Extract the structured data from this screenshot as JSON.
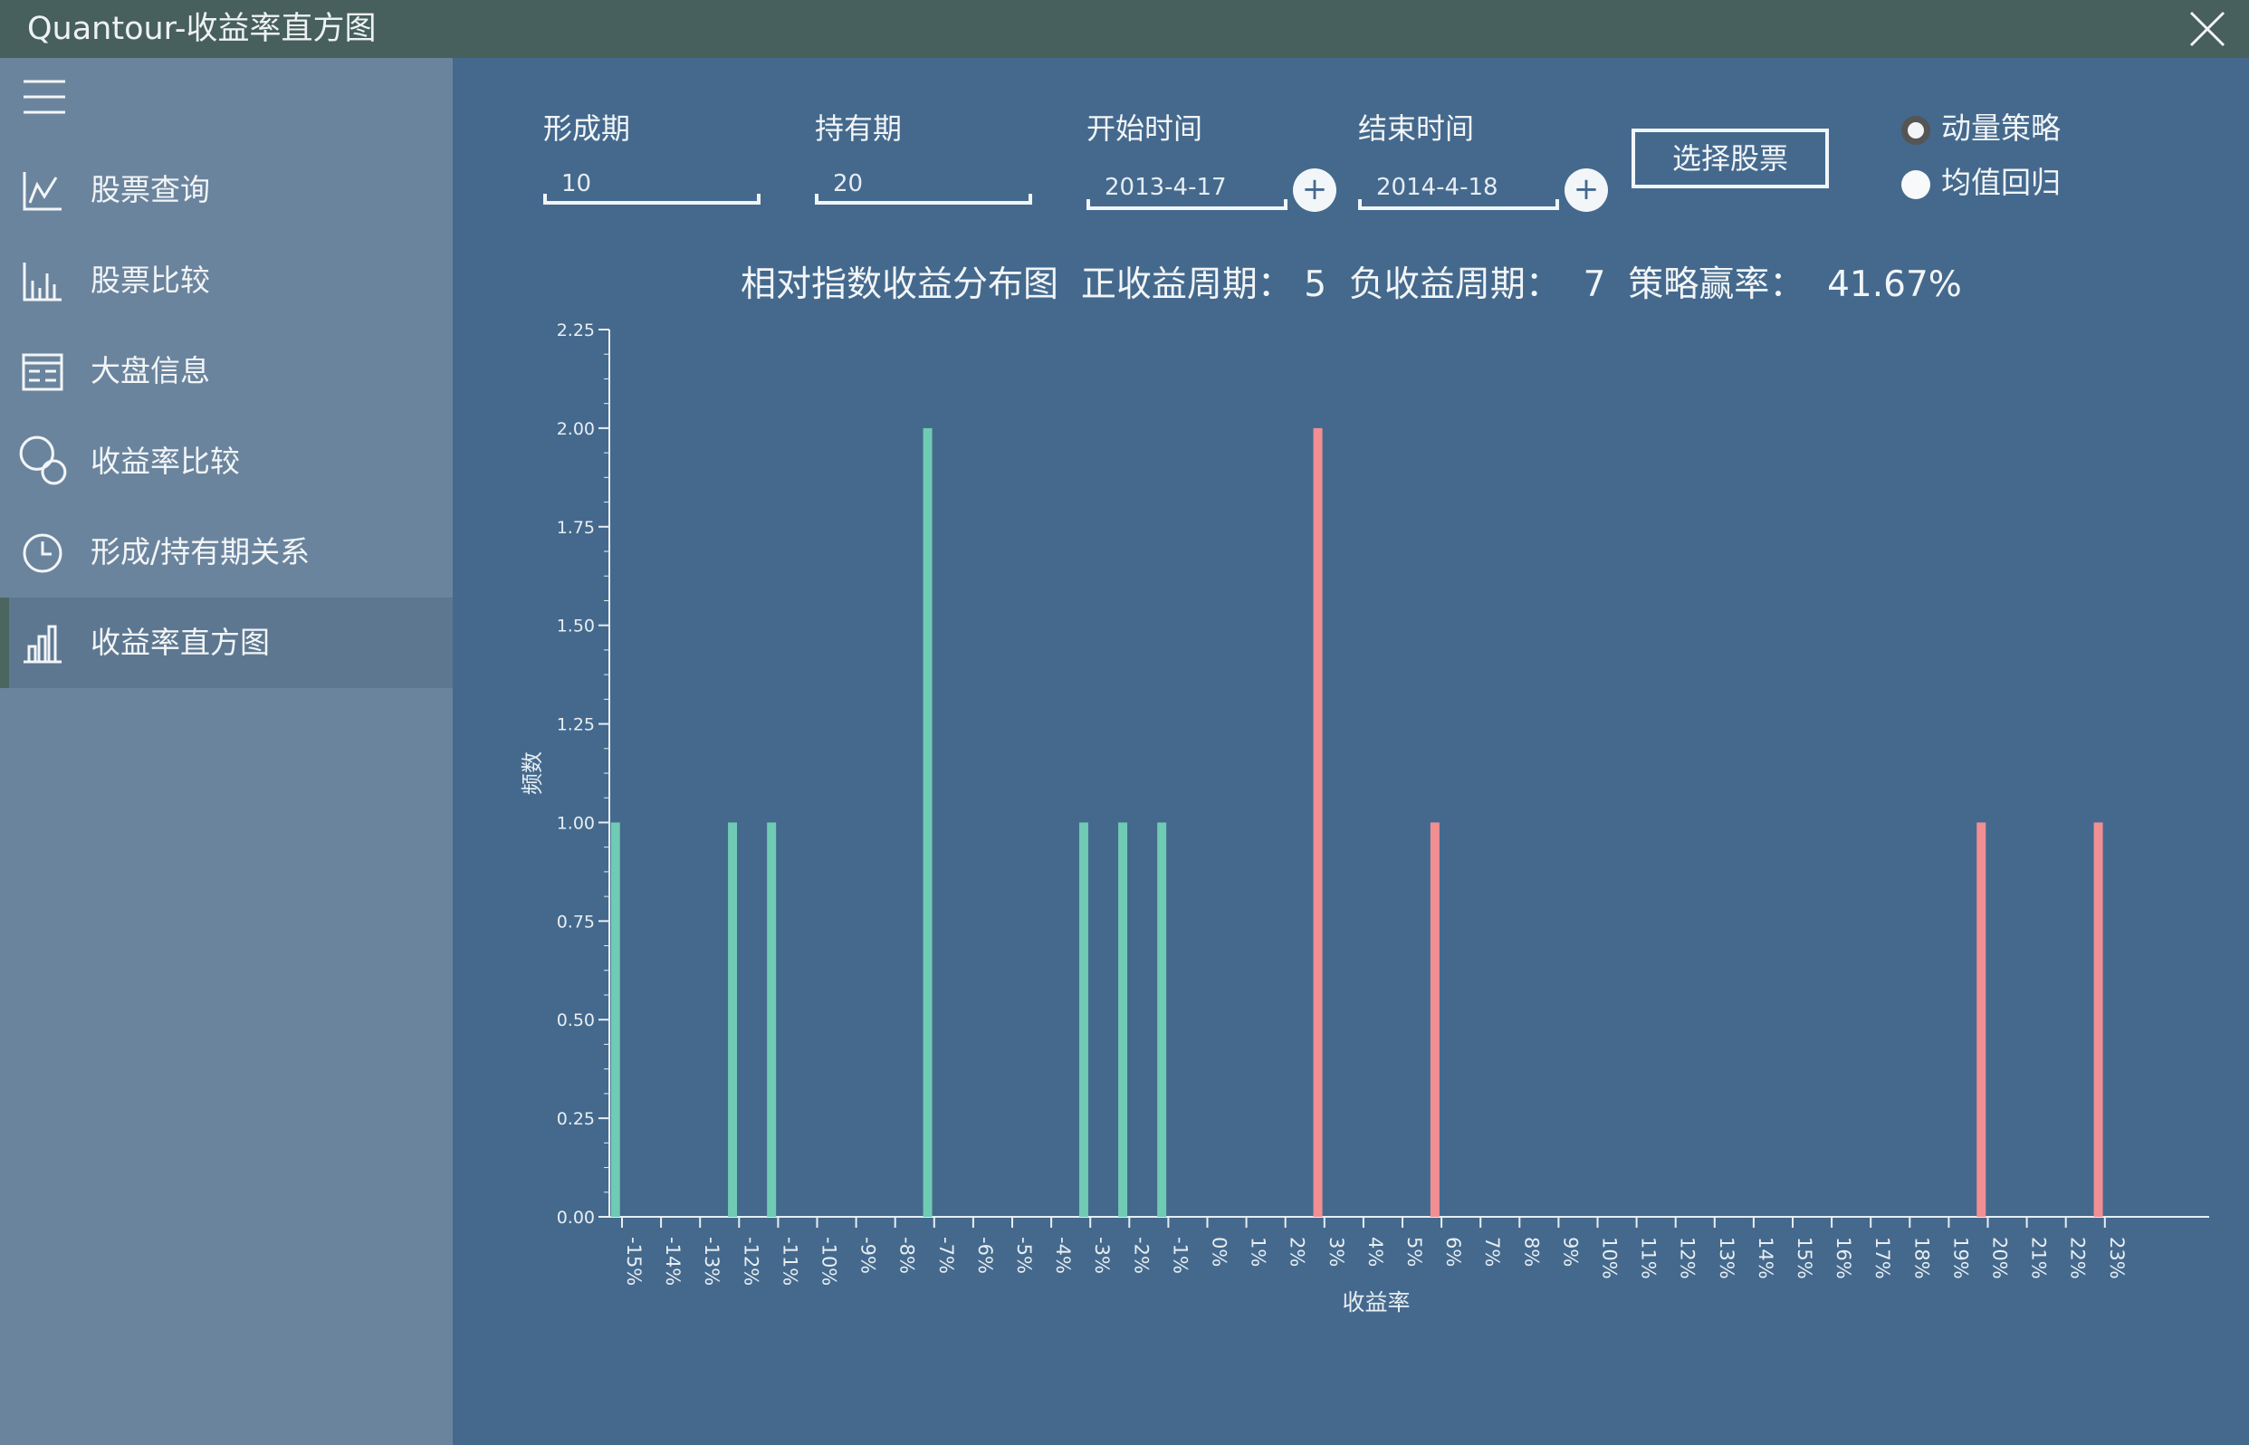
{
  "window": {
    "title": "Quantour-收益率直方图"
  },
  "sidebar": {
    "items": [
      {
        "label": "股票查询",
        "icon": "line-chart-icon"
      },
      {
        "label": "股票比较",
        "icon": "bar-chart-icon"
      },
      {
        "label": "大盘信息",
        "icon": "list-board-icon"
      },
      {
        "label": "收益率比较",
        "icon": "overlap-circles-icon"
      },
      {
        "label": "形成/持有期关系",
        "icon": "clock-icon"
      },
      {
        "label": "收益率直方图",
        "icon": "histogram-icon",
        "active": true
      }
    ]
  },
  "form": {
    "formation_label": "形成期",
    "formation_value": "10",
    "holding_label": "持有期",
    "holding_value": "20",
    "start_label": "开始时间",
    "start_value": "2013-4-17",
    "end_label": "结束时间",
    "end_value": "2014-4-18",
    "plus_symbol": "+",
    "select_button": "选择股票",
    "strategy_options": [
      {
        "label": "动量策略",
        "selected": true
      },
      {
        "label": "均值回归",
        "selected": false
      }
    ]
  },
  "summary": {
    "chart_name": "相对指数收益分布图",
    "positive_label": "正收益周期：",
    "positive_value": "5",
    "negative_label": "负收益周期：",
    "negative_value": "7",
    "winrate_label": "策略赢率：",
    "winrate_value": "41.67%"
  },
  "colors": {
    "negative_bar": "#6fcbb3",
    "positive_bar": "#f28f93",
    "axis": "#e8eef3",
    "background": "#44698d"
  },
  "chart_data": {
    "type": "bar",
    "xlabel": "收益率",
    "ylabel": "频数",
    "ylim": [
      0,
      2.25
    ],
    "yticks": [
      "0.00",
      "0.25",
      "0.50",
      "0.75",
      "1.00",
      "1.25",
      "1.50",
      "1.75",
      "2.00",
      "2.25"
    ],
    "categories": [
      "-15%",
      "-14%",
      "-13%",
      "-12%",
      "-11%",
      "-10%",
      "-9%",
      "-8%",
      "-7%",
      "-6%",
      "-5%",
      "-4%",
      "-3%",
      "-2%",
      "-1%",
      "0%",
      "1%",
      "2%",
      "3%",
      "4%",
      "5%",
      "6%",
      "7%",
      "8%",
      "9%",
      "10%",
      "11%",
      "12%",
      "13%",
      "14%",
      "15%",
      "16%",
      "17%",
      "18%",
      "19%",
      "20%",
      "21%",
      "22%",
      "23%"
    ],
    "bars": [
      {
        "x": -15.4,
        "value": 1,
        "sign": "negative"
      },
      {
        "x": -12.4,
        "value": 1,
        "sign": "negative"
      },
      {
        "x": -11.4,
        "value": 1,
        "sign": "negative"
      },
      {
        "x": -7.4,
        "value": 2,
        "sign": "negative"
      },
      {
        "x": -3.4,
        "value": 1,
        "sign": "negative"
      },
      {
        "x": -2.4,
        "value": 1,
        "sign": "negative"
      },
      {
        "x": -1.4,
        "value": 1,
        "sign": "negative"
      },
      {
        "x": 2.6,
        "value": 2,
        "sign": "positive"
      },
      {
        "x": 5.6,
        "value": 1,
        "sign": "positive"
      },
      {
        "x": 19.6,
        "value": 1,
        "sign": "positive"
      },
      {
        "x": 22.6,
        "value": 1,
        "sign": "positive"
      }
    ]
  }
}
